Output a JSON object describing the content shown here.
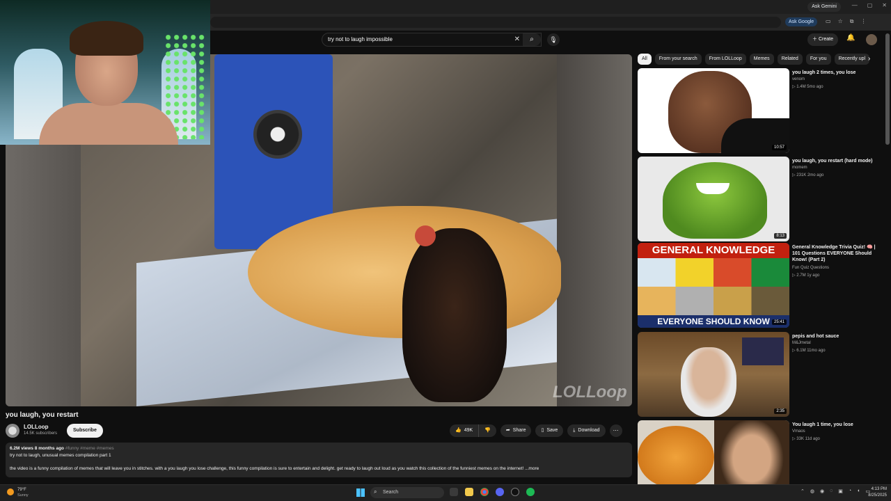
{
  "browser": {
    "ask_gemini": "Ask Gemini",
    "ask_google": "Ask Google"
  },
  "header": {
    "search_query": "try not to laugh impossible",
    "create_label": "Create"
  },
  "video": {
    "watermark": "LOLLoop",
    "title": "you laugh, you restart",
    "channel": "LOLLoop",
    "subscribers": "14.5K subscribers",
    "subscribe_label": "Subscribe",
    "likes": "49K",
    "share_label": "Share",
    "save_label": "Save",
    "download_label": "Download",
    "stats": "6.2M views  8 months ago",
    "tags": "#funny #meme #memes",
    "desc_line1": "try not to laugh, unusual memes compilation part 1",
    "desc_line2": "the video is a funny compilation of memes that will leave you in stitches. with a you laugh you lose challenge, this funny compilation is sure to entertain and delight. get ready to laugh out loud as you watch this collection of the funniest memes on the internet!",
    "more_label": "...more"
  },
  "chips": [
    "All",
    "From your search",
    "From LOLLoop",
    "Memes",
    "Related",
    "For you",
    "Recently upl"
  ],
  "recommendations": [
    {
      "title": "you laugh 2 times, you lose",
      "channel": "venom",
      "meta": "▷ 1.4M  5mo ago",
      "duration": "10:57"
    },
    {
      "title": "you laugh, you restart (hard mode)",
      "channel": "momem",
      "meta": "▷ 231K  2mo ago",
      "duration": "8:13"
    },
    {
      "title": "General Knowledge Trivia Quiz! 🧠 | 101 Questions EVERYONE Should Know! (Part 2)",
      "channel": "Fun Quiz Questions",
      "meta": "▷ 2.7M  1y ago",
      "duration": "25:41",
      "thumb_top": "GENERAL KNOWLEDGE",
      "thumb_bottom": "EVERYONE SHOULD KNOW"
    },
    {
      "title": "pepis and hot sauce",
      "channel": "M&Jmetal",
      "meta": "▷ 6.1M  11mo ago",
      "duration": "2:35"
    },
    {
      "title": "You laugh 1 time, you lose",
      "channel": "Vmaos",
      "meta": "▷ 33K  11d ago",
      "duration": ""
    }
  ],
  "taskbar": {
    "weather_temp": "79°F",
    "weather_cond": "Sunny",
    "search_label": "Search",
    "time": "4:13 PM",
    "date": "8/25/2025"
  },
  "colors": {
    "background": "#0f0f0f",
    "surface": "#272727",
    "accent_blue": "#3ea6ff"
  }
}
